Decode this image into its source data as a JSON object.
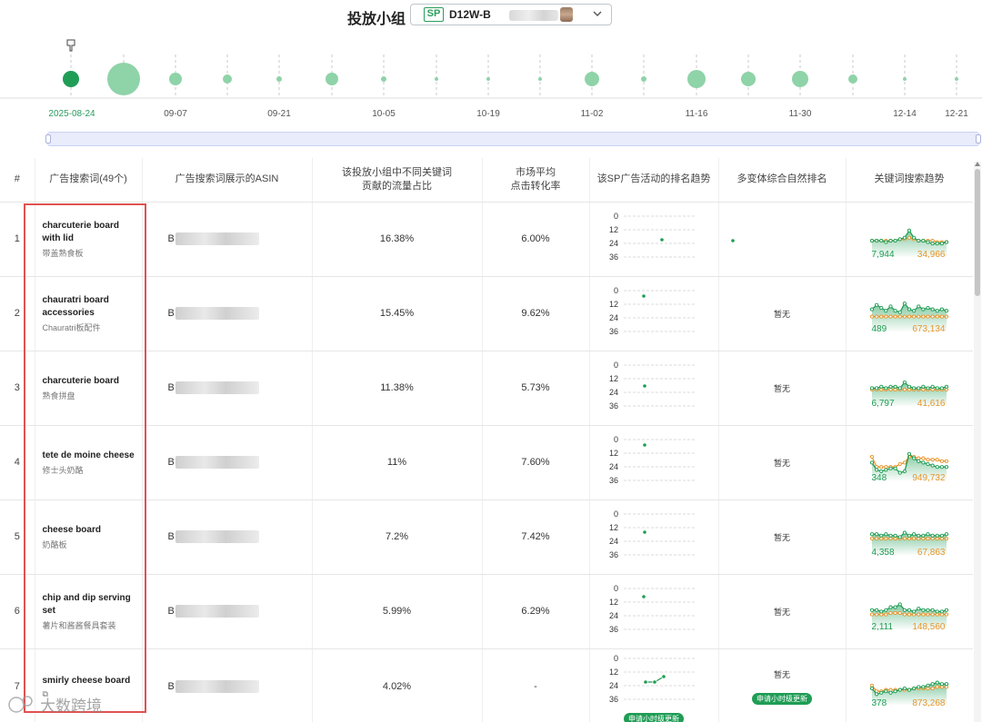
{
  "header": {
    "group_label": "投放小组",
    "select_badge": "SP",
    "select_value": "D12W-B"
  },
  "timeline": {
    "dates": [
      "2025-08-24",
      "09-07",
      "09-21",
      "10-05",
      "10-19",
      "11-02",
      "11-16",
      "11-30",
      "12-14",
      "12-21"
    ],
    "active_date": "2025-08-24"
  },
  "table": {
    "headers": {
      "index": "#",
      "keyword": "广告搜索词(49个)",
      "asin": "广告搜索词展示的ASIN",
      "share_line1": "该投放小组中不同关键词",
      "share_line2": "贡献的流量占比",
      "cvr_line1": "市场平均",
      "cvr_line2": "点击转化率",
      "rank": "该SP广告活动的排名趋势",
      "organic": "多变体综合自然排名",
      "search": "关键词搜索趋势"
    },
    "rank_axis": [
      "0",
      "12",
      "24",
      "36"
    ],
    "no_data": "暂无",
    "update_badge": "申请小时级更新",
    "rows": [
      {
        "idx": "1",
        "kw_en": "charcuterie board with lid",
        "kw_cn": "带盖熟食板",
        "asin_prefix": "B",
        "share": "16.38%",
        "cvr": "6.00%",
        "organic": "",
        "search_low": "7,944",
        "search_high": "34,966"
      },
      {
        "idx": "2",
        "kw_en": "chauratri board accessories",
        "kw_cn": "Chauratri板配件",
        "asin_prefix": "B",
        "share": "15.45%",
        "cvr": "9.62%",
        "organic": "暂无",
        "search_low": "489",
        "search_high": "673,134"
      },
      {
        "idx": "3",
        "kw_en": "charcuterie board",
        "kw_cn": "熟食拼盘",
        "asin_prefix": "B",
        "share": "11.38%",
        "cvr": "5.73%",
        "organic": "暂无",
        "search_low": "6,797",
        "search_high": "41,616"
      },
      {
        "idx": "4",
        "kw_en": "tete de moine cheese",
        "kw_cn": "修士头奶酪",
        "asin_prefix": "B",
        "share": "11%",
        "cvr": "7.60%",
        "organic": "暂无",
        "search_low": "348",
        "search_high": "949,732"
      },
      {
        "idx": "5",
        "kw_en": "cheese board",
        "kw_cn": "奶酪板",
        "asin_prefix": "B",
        "share": "7.2%",
        "cvr": "7.42%",
        "organic": "暂无",
        "search_low": "4,358",
        "search_high": "67,863"
      },
      {
        "idx": "6",
        "kw_en": "chip and dip serving set",
        "kw_cn": "薯片和酱酱餐具套装",
        "asin_prefix": "B",
        "share": "5.99%",
        "cvr": "6.29%",
        "organic": "暂无",
        "search_low": "2,111",
        "search_high": "148,560"
      },
      {
        "idx": "7",
        "kw_en": "smirly cheese board",
        "kw_cn": "",
        "asin_prefix": "B",
        "share": "4.02%",
        "cvr": "-",
        "organic": "暂无",
        "search_low": "378",
        "search_high": "873,268"
      }
    ]
  },
  "watermark": "大数跨境",
  "colors": {
    "green": "#1f9d55",
    "orange": "#e8952c",
    "bubble": "#8fd3a8",
    "red_box": "#e05252"
  }
}
